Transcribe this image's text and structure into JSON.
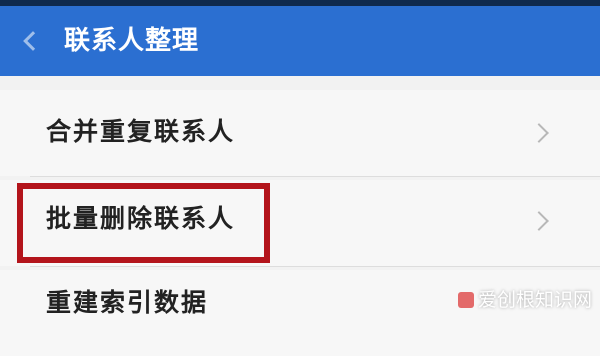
{
  "header": {
    "title": "联系人整理",
    "back_icon": "chevron-left-icon"
  },
  "list": {
    "items": [
      {
        "label": "合并重复联系人",
        "icon": "chevron-right-icon"
      },
      {
        "label": "批量删除联系人",
        "icon": "chevron-right-icon"
      },
      {
        "label": "重建索引数据"
      }
    ]
  },
  "annotation": {
    "highlight_color": "#b3141b"
  },
  "watermark": {
    "text": "爱创根知识网"
  },
  "colors": {
    "header_bg": "#2b6fd1",
    "status_bar": "#0f2a4d",
    "list_bg": "#f2f2f2",
    "text": "#222222"
  }
}
